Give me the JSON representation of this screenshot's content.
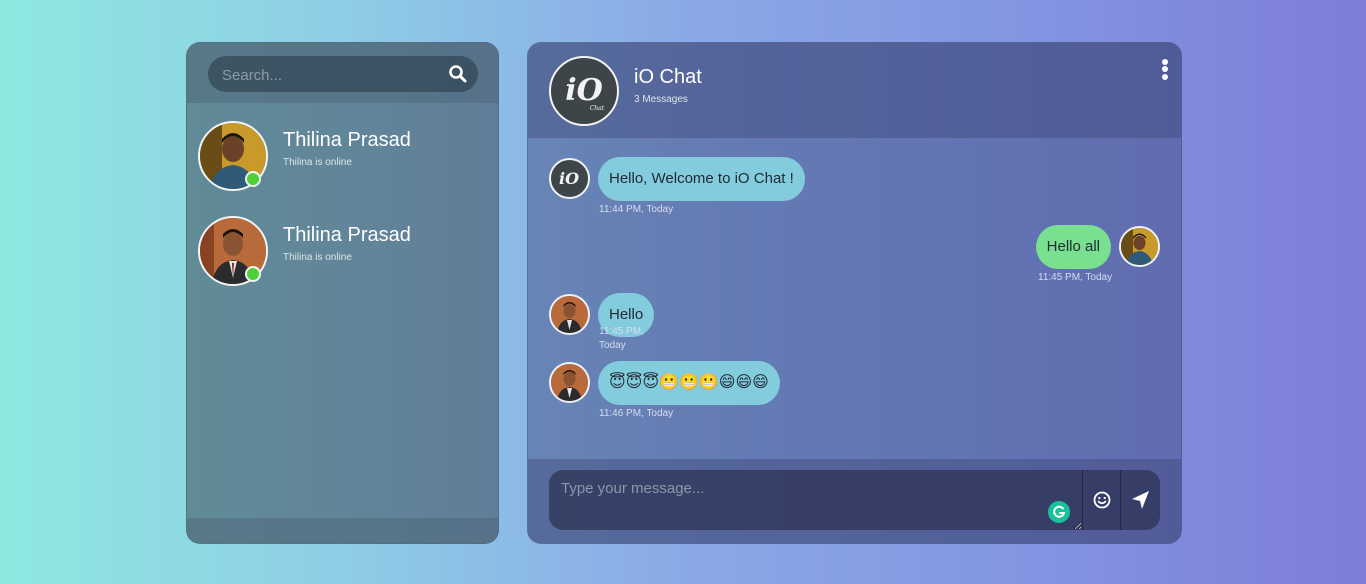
{
  "search": {
    "placeholder": "Search..."
  },
  "contacts": [
    {
      "name": "Thilina Prasad",
      "status": "Thilina is online",
      "online": true
    },
    {
      "name": "Thilina Prasad",
      "status": "Thilina is online",
      "online": true
    }
  ],
  "chat": {
    "title": "iO Chat",
    "message_count": "3 Messages",
    "logo_text": "iO",
    "logo_subtext": "Chat",
    "messages": [
      {
        "direction": "in",
        "sender_avatar": "io-logo",
        "text": "Hello, Welcome to iO Chat !",
        "time": "11:44 PM, Today"
      },
      {
        "direction": "out",
        "sender_avatar": "user-photo-1",
        "text": "Hello all",
        "time": "11:45 PM, Today"
      },
      {
        "direction": "in",
        "sender_avatar": "user-photo-2",
        "text": "Hello",
        "time_line1": "11:45 PM,",
        "time_line2": "Today"
      },
      {
        "direction": "in",
        "sender_avatar": "user-photo-2",
        "text": "😇😇😇😬😬😬😄😄😄",
        "time": "11:46 PM, Today"
      }
    ]
  },
  "composer": {
    "placeholder": "Type your message..."
  },
  "icons": {
    "search": "search-icon",
    "menu": "more-vertical-icon",
    "emoji": "smiley-icon",
    "send": "send-arrow-icon",
    "grammarly": "grammarly-icon"
  },
  "colors": {
    "incoming_bubble": "#82ccdd",
    "outgoing_bubble": "#78e08f",
    "online_dot": "#4cd137"
  }
}
